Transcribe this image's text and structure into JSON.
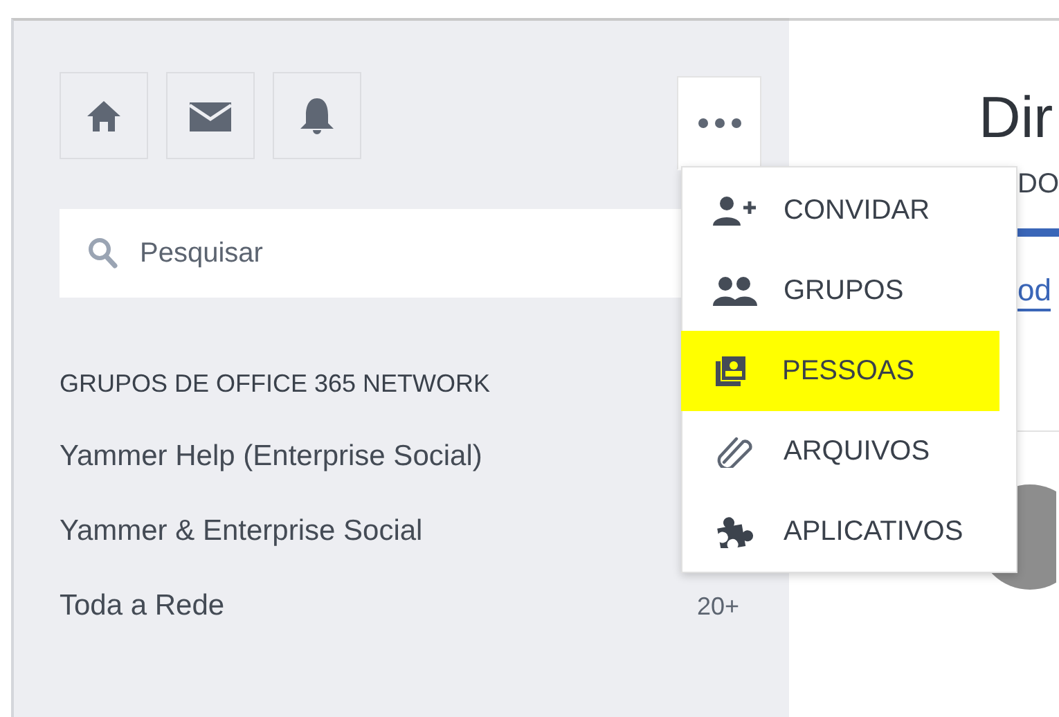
{
  "sidebar": {
    "search": {
      "placeholder": "Pesquisar"
    },
    "heading": "GRUPOS DE OFFICE 365 NETWORK",
    "groups": [
      {
        "name": "Yammer Help (Enterprise Social)"
      },
      {
        "name": "Yammer & Enterprise Social"
      },
      {
        "name": "Toda a Rede",
        "count": "20+"
      }
    ]
  },
  "more_menu": {
    "expanded": true,
    "items": [
      {
        "label": "CONVIDAR",
        "highlighted": false
      },
      {
        "label": "GRUPOS",
        "highlighted": false
      },
      {
        "label": "PESSOAS",
        "highlighted": true
      },
      {
        "label": "ARQUIVOS",
        "highlighted": false
      },
      {
        "label": "APLICATIVOS",
        "highlighted": false
      }
    ]
  },
  "main": {
    "title": "Dir",
    "tabs": [
      {
        "label": "DO",
        "selected": true
      }
    ],
    "link": "od"
  }
}
